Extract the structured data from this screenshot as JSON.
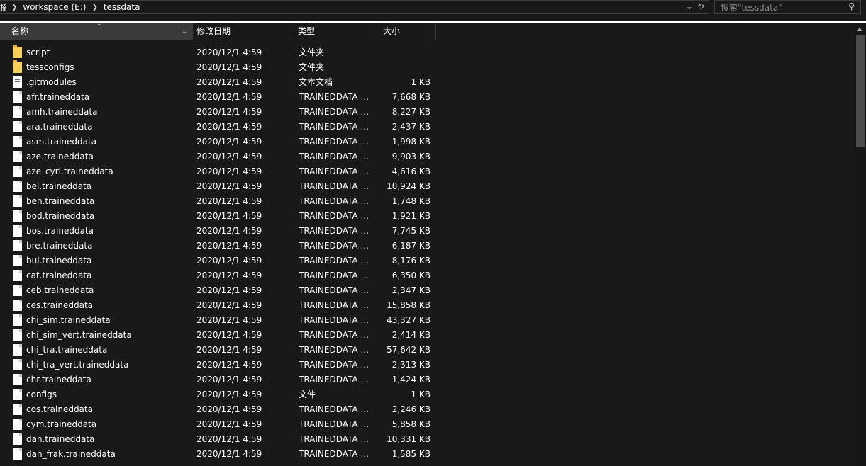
{
  "address": {
    "fragment": "摘",
    "crumbs": [
      "workspace (E:)",
      "tessdata"
    ]
  },
  "search": {
    "placeholder": "搜索\"tessdata\""
  },
  "columns": {
    "name": "名称",
    "date": "修改日期",
    "type": "类型",
    "size": "大小"
  },
  "files": [
    {
      "name": "script",
      "date": "2020/12/1 4:59",
      "type": "文件夹",
      "size": "",
      "icon": "folder-icon"
    },
    {
      "name": "tessconfigs",
      "date": "2020/12/1 4:59",
      "type": "文件夹",
      "size": "",
      "icon": "folder-icon"
    },
    {
      "name": ".gitmodules",
      "date": "2020/12/1 4:59",
      "type": "文本文档",
      "size": "1 KB",
      "icon": "text-file-icon"
    },
    {
      "name": "afr.traineddata",
      "date": "2020/12/1 4:59",
      "type": "TRAINEDDATA ...",
      "size": "7,668 KB",
      "icon": "file-icon"
    },
    {
      "name": "amh.traineddata",
      "date": "2020/12/1 4:59",
      "type": "TRAINEDDATA ...",
      "size": "8,227 KB",
      "icon": "file-icon"
    },
    {
      "name": "ara.traineddata",
      "date": "2020/12/1 4:59",
      "type": "TRAINEDDATA ...",
      "size": "2,437 KB",
      "icon": "file-icon"
    },
    {
      "name": "asm.traineddata",
      "date": "2020/12/1 4:59",
      "type": "TRAINEDDATA ...",
      "size": "1,998 KB",
      "icon": "file-icon"
    },
    {
      "name": "aze.traineddata",
      "date": "2020/12/1 4:59",
      "type": "TRAINEDDATA ...",
      "size": "9,903 KB",
      "icon": "file-icon"
    },
    {
      "name": "aze_cyrl.traineddata",
      "date": "2020/12/1 4:59",
      "type": "TRAINEDDATA ...",
      "size": "4,616 KB",
      "icon": "file-icon"
    },
    {
      "name": "bel.traineddata",
      "date": "2020/12/1 4:59",
      "type": "TRAINEDDATA ...",
      "size": "10,924 KB",
      "icon": "file-icon"
    },
    {
      "name": "ben.traineddata",
      "date": "2020/12/1 4:59",
      "type": "TRAINEDDATA ...",
      "size": "1,748 KB",
      "icon": "file-icon"
    },
    {
      "name": "bod.traineddata",
      "date": "2020/12/1 4:59",
      "type": "TRAINEDDATA ...",
      "size": "1,921 KB",
      "icon": "file-icon"
    },
    {
      "name": "bos.traineddata",
      "date": "2020/12/1 4:59",
      "type": "TRAINEDDATA ...",
      "size": "7,745 KB",
      "icon": "file-icon"
    },
    {
      "name": "bre.traineddata",
      "date": "2020/12/1 4:59",
      "type": "TRAINEDDATA ...",
      "size": "6,187 KB",
      "icon": "file-icon"
    },
    {
      "name": "bul.traineddata",
      "date": "2020/12/1 4:59",
      "type": "TRAINEDDATA ...",
      "size": "8,176 KB",
      "icon": "file-icon"
    },
    {
      "name": "cat.traineddata",
      "date": "2020/12/1 4:59",
      "type": "TRAINEDDATA ...",
      "size": "6,350 KB",
      "icon": "file-icon"
    },
    {
      "name": "ceb.traineddata",
      "date": "2020/12/1 4:59",
      "type": "TRAINEDDATA ...",
      "size": "2,347 KB",
      "icon": "file-icon"
    },
    {
      "name": "ces.traineddata",
      "date": "2020/12/1 4:59",
      "type": "TRAINEDDATA ...",
      "size": "15,858 KB",
      "icon": "file-icon"
    },
    {
      "name": "chi_sim.traineddata",
      "date": "2020/12/1 4:59",
      "type": "TRAINEDDATA ...",
      "size": "43,327 KB",
      "icon": "file-icon"
    },
    {
      "name": "chi_sim_vert.traineddata",
      "date": "2020/12/1 4:59",
      "type": "TRAINEDDATA ...",
      "size": "2,414 KB",
      "icon": "file-icon"
    },
    {
      "name": "chi_tra.traineddata",
      "date": "2020/12/1 4:59",
      "type": "TRAINEDDATA ...",
      "size": "57,642 KB",
      "icon": "file-icon"
    },
    {
      "name": "chi_tra_vert.traineddata",
      "date": "2020/12/1 4:59",
      "type": "TRAINEDDATA ...",
      "size": "2,313 KB",
      "icon": "file-icon"
    },
    {
      "name": "chr.traineddata",
      "date": "2020/12/1 4:59",
      "type": "TRAINEDDATA ...",
      "size": "1,424 KB",
      "icon": "file-icon"
    },
    {
      "name": "configs",
      "date": "2020/12/1 4:59",
      "type": "文件",
      "size": "1 KB",
      "icon": "file-icon"
    },
    {
      "name": "cos.traineddata",
      "date": "2020/12/1 4:59",
      "type": "TRAINEDDATA ...",
      "size": "2,246 KB",
      "icon": "file-icon"
    },
    {
      "name": "cym.traineddata",
      "date": "2020/12/1 4:59",
      "type": "TRAINEDDATA ...",
      "size": "5,858 KB",
      "icon": "file-icon"
    },
    {
      "name": "dan.traineddata",
      "date": "2020/12/1 4:59",
      "type": "TRAINEDDATA ...",
      "size": "10,331 KB",
      "icon": "file-icon"
    },
    {
      "name": "dan_frak.traineddata",
      "date": "2020/12/1 4:59",
      "type": "TRAINEDDATA ...",
      "size": "1,585 KB",
      "icon": "file-icon"
    }
  ]
}
